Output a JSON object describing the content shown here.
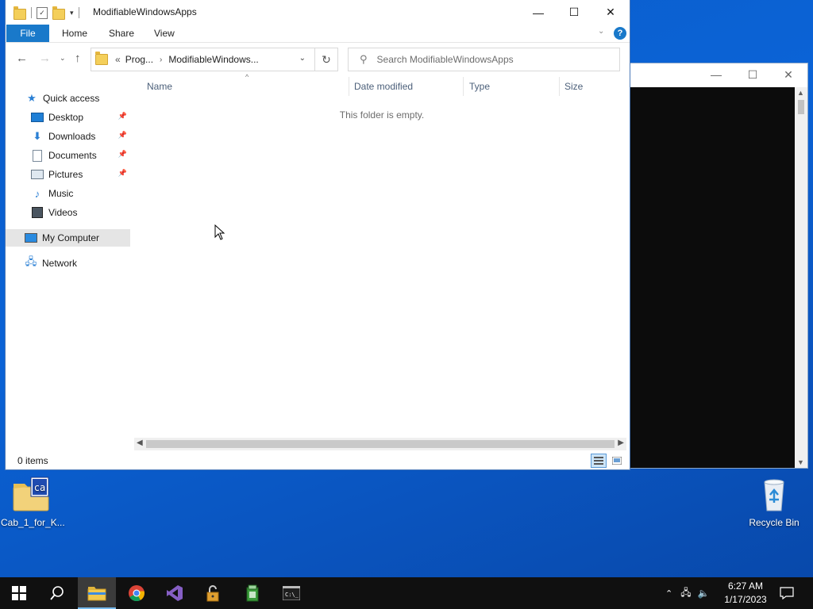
{
  "desktop": {
    "icons": [
      {
        "label": "Cab_1_for_K..."
      },
      {
        "label": "Recycle Bin"
      }
    ]
  },
  "explorer": {
    "title": "ModifiableWindowsApps",
    "ribbon": {
      "file_tab": "File",
      "tabs": [
        "Home",
        "Share",
        "View"
      ],
      "help": "?"
    },
    "address": {
      "overflow": "«",
      "crumbs": [
        "Prog...",
        "ModifiableWindows..."
      ]
    },
    "search": {
      "placeholder": "Search ModifiableWindowsApps"
    },
    "nav_pane": {
      "quick_access": "Quick access",
      "pinned": [
        "Desktop",
        "Downloads",
        "Documents",
        "Pictures"
      ],
      "unpinned": [
        "Music",
        "Videos"
      ],
      "my_computer": "My Computer",
      "network": "Network"
    },
    "columns": [
      "Name",
      "Date modified",
      "Type",
      "Size"
    ],
    "empty_message": "This folder is empty.",
    "status": {
      "count": "0 items"
    }
  },
  "taskbar": {
    "clock_time": "6:27 AM",
    "clock_date": "1/17/2023"
  },
  "colors": {
    "accent": "#1979ca",
    "desktop": "#0b63d6",
    "taskbar": "#101010"
  }
}
